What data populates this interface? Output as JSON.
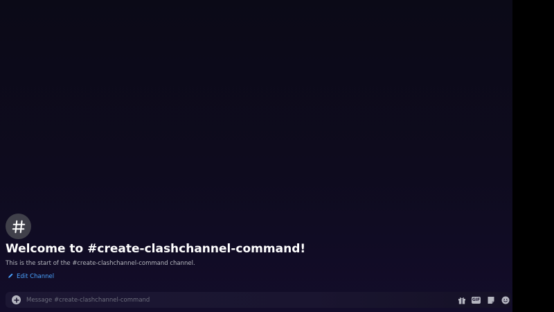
{
  "welcome": {
    "title": "Welcome to #create-clashchannel-command!",
    "subtitle": "This is the start of the #create-clashchannel-command channel.",
    "edit_label": "Edit Channel"
  },
  "composer": {
    "placeholder": "Message #create-clashchannel-command",
    "gif_label": "GIF",
    "icons": [
      "gift-icon",
      "gif-icon",
      "sticker-icon",
      "emoji-icon"
    ]
  },
  "colors": {
    "accent_link": "#4aa3ff",
    "background": "#0e0b1e",
    "title": "#ffffff"
  }
}
